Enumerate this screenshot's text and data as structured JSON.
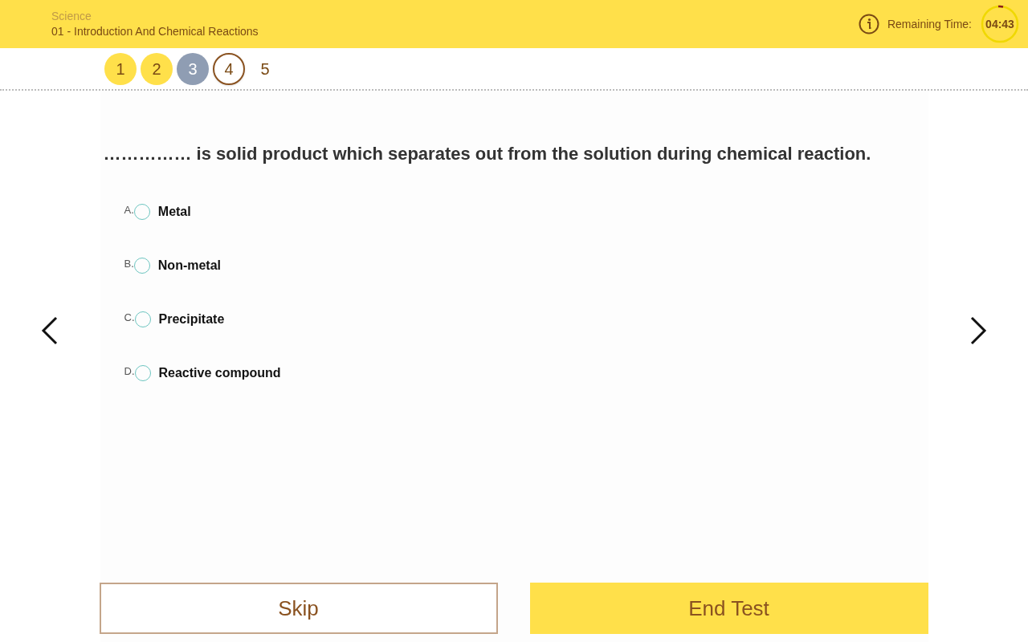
{
  "header": {
    "subject": "Science",
    "chapter": "01 - Introduction And Chemical Reactions",
    "timer_label": "Remaining Time:",
    "timer": "04:43"
  },
  "question_nav": [
    {
      "label": "1",
      "kind": "answered",
      "selected": false
    },
    {
      "label": "2",
      "kind": "answered",
      "selected": false
    },
    {
      "label": "3",
      "kind": "skipped",
      "selected": false
    },
    {
      "label": "4",
      "kind": "current",
      "selected": true
    },
    {
      "label": "5",
      "kind": "unvisited",
      "selected": false
    }
  ],
  "question": "…………… is solid product which separates out from the solution during chemical reaction.",
  "options": [
    {
      "letter": "A.",
      "text": "Metal",
      "checked": false
    },
    {
      "letter": "B.",
      "text": "Non-metal",
      "checked": false
    },
    {
      "letter": "C.",
      "text": "Precipitate",
      "checked": false
    },
    {
      "letter": "D.",
      "text": "Reactive compound",
      "checked": false
    }
  ],
  "buttons": {
    "skip": "Skip",
    "end": "End Test"
  }
}
